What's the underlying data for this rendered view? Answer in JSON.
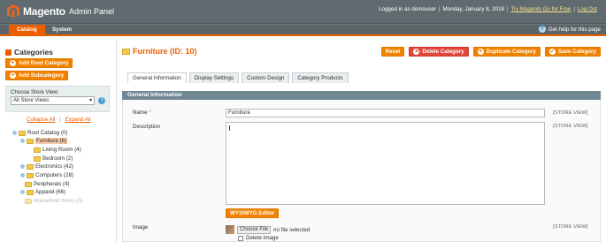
{
  "header": {
    "logo_text": "Magento",
    "logo_sub": "Admin Panel",
    "logged_in": "Logged in as demouser",
    "date": "Monday, January 8, 2018",
    "try_link": "Try Magento Go for Free",
    "logout": "Log Out"
  },
  "nav": {
    "tabs": [
      "Catalog",
      "System"
    ],
    "help": "Get help for this page"
  },
  "sidebar": {
    "title": "Categories",
    "add_root": "Add Root Category",
    "add_sub": "Add Subcategory",
    "store_label": "Choose Store View:",
    "store_value": "All Store Views",
    "collapse": "Collapse All",
    "expand": "Expand All",
    "sep": "|",
    "tree": [
      "Root Catalog (0)",
      "Furniture (6)",
      "Living Room (4)",
      "Bedroom (2)",
      "Electronics (42)",
      "Computers (28)",
      "Peripherals (4)",
      "Apparel (66)",
      "Household Items (0)"
    ]
  },
  "main": {
    "title": "Furniture (ID: 10)",
    "actions": {
      "reset": "Reset",
      "delete": "Delete Category",
      "duplicate": "Duplicate Category",
      "save": "Save Category"
    },
    "tabs": [
      "General Information",
      "Display Settings",
      "Custom Design",
      "Category Products"
    ],
    "section": "General Information",
    "fields": {
      "name_label": "Name",
      "name_req": "*",
      "name_value": "Furniture",
      "desc_label": "Description",
      "image_label": "Image",
      "scope": "[STORE VIEW]",
      "wysiwyg": "WYSIWYG Editor",
      "choose_file": "Choose File",
      "no_file": "no file selected",
      "delete_image": "Delete Image"
    }
  },
  "colors": {
    "accent": "#eb5e00",
    "header": "#5f6b6f",
    "section": "#6f8892"
  }
}
